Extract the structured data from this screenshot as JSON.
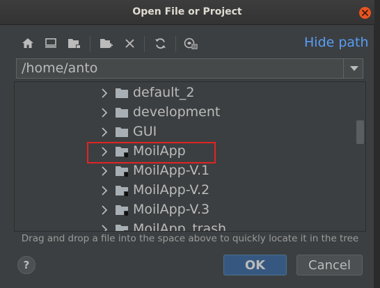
{
  "window": {
    "title": "Open File or Project",
    "close_icon": "close-icon"
  },
  "toolbar": {
    "buttons": [
      {
        "name": "home-button",
        "icon": "home-icon"
      },
      {
        "name": "desktop-button",
        "icon": "desktop-icon"
      },
      {
        "name": "project-button",
        "icon": "project-folder-icon"
      },
      {
        "name": "new-folder-button",
        "icon": "new-folder-icon"
      },
      {
        "name": "delete-button",
        "icon": "delete-icon"
      },
      {
        "name": "refresh-button",
        "icon": "refresh-icon"
      },
      {
        "name": "show-hidden-button",
        "icon": "show-hidden-icon"
      }
    ],
    "hide_path_label": "Hide path"
  },
  "path": {
    "value": "/home/anto"
  },
  "tree": {
    "items": [
      {
        "label": "default_2",
        "module": false
      },
      {
        "label": "development",
        "module": false
      },
      {
        "label": "GUI",
        "module": false
      },
      {
        "label": "MoilApp",
        "module": true,
        "highlighted": true
      },
      {
        "label": "MoilApp-V.1",
        "module": true
      },
      {
        "label": "MoilApp-V.2",
        "module": true
      },
      {
        "label": "MoilApp-V.3",
        "module": true
      },
      {
        "label": "MoilApp_trash",
        "module": true
      }
    ]
  },
  "hint": "Drag and drop a file into the space above to quickly locate it in the tree",
  "buttons": {
    "help": "?",
    "ok": "OK",
    "cancel": "Cancel"
  },
  "colors": {
    "accent_link": "#589df6",
    "ok_button": "#365880",
    "close_button": "#e95420",
    "highlight_border": "#e02424"
  }
}
